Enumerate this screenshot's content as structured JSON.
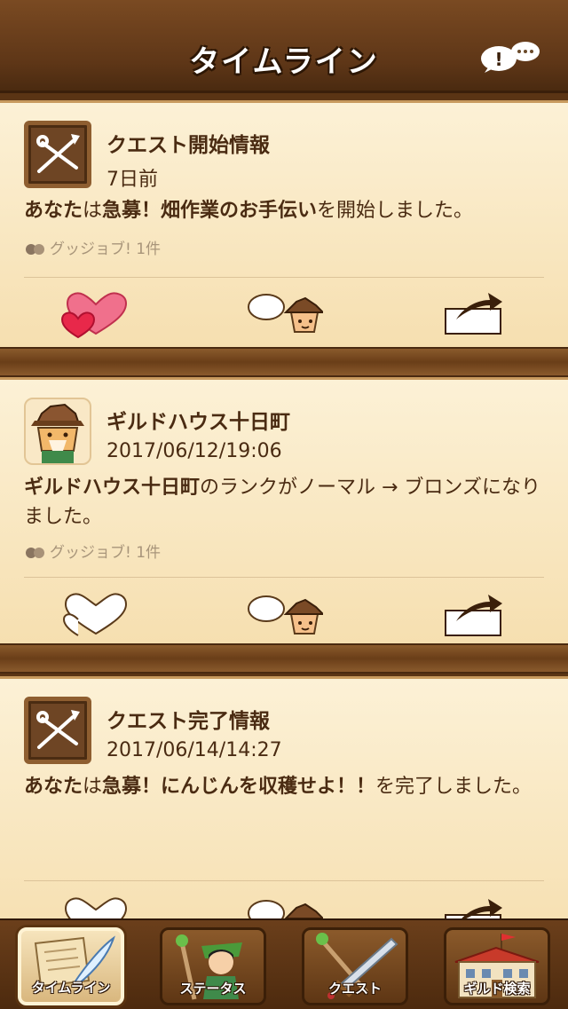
{
  "header": {
    "title": "タイムライン"
  },
  "timeline": [
    {
      "title": "クエスト開始情報",
      "time": "7日前",
      "message_parts": [
        "あなた",
        "は",
        "急募！畑作業のお手伝い",
        "を開始しました。"
      ],
      "goodjob": "グッジョブ! 1件",
      "icon": "quest-icon",
      "liked": true
    },
    {
      "title": "ギルドハウス十日町",
      "time": "2017/06/12/19:06",
      "message_parts": [
        "ギルドハウス十日町",
        "のランクがノーマル → ブロンズになりました。"
      ],
      "goodjob": "グッジョブ! 1件",
      "icon": "guild-avatar",
      "liked": false
    },
    {
      "title": "クエスト完了情報",
      "time": "2017/06/14/14:27",
      "message_parts": [
        "あなた",
        "は",
        "急募！にんじんを収穫せよ！！",
        "を完了しました。"
      ],
      "icon": "quest-icon",
      "liked": false
    }
  ],
  "tabs": [
    {
      "label": "タイムライン",
      "icon": "scroll-quill-icon",
      "active": true
    },
    {
      "label": "ステータス",
      "icon": "character-icon",
      "active": false
    },
    {
      "label": "クエスト",
      "icon": "sword-staff-icon",
      "active": false
    },
    {
      "label": "ギルド検索",
      "icon": "guild-building-icon",
      "active": false
    }
  ],
  "colors": {
    "header": "#5e3617",
    "card": "#fcf1d6",
    "text": "#4a2b12",
    "heart": "#e84a6a"
  }
}
